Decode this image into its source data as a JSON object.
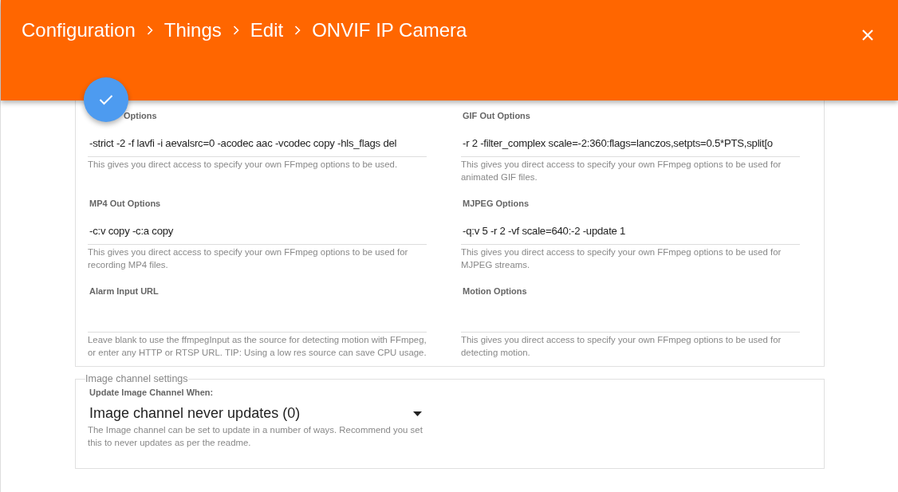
{
  "header": {
    "breadcrumb": [
      "Configuration",
      "Things",
      "Edit",
      "ONVIF IP Camera"
    ]
  },
  "options_group": {
    "fields": [
      {
        "label": "Options",
        "value": "-strict -2 -f lavfi -i aevalsrc=0 -acodec aac -vcodec copy -hls_flags del",
        "hint": "This gives you direct access to specify your own FFmpeg options to be used."
      },
      {
        "label": "GIF Out Options",
        "value": "-r 2 -filter_complex scale=-2:360:flags=lanczos,setpts=0.5*PTS,split[o",
        "hint": "This gives you direct access to specify your own FFmpeg options to be used for animated GIF files."
      },
      {
        "label": "MP4 Out Options",
        "value": "-c:v copy -c:a copy",
        "hint": "This gives you direct access to specify your own FFmpeg options to be used for recording MP4 files."
      },
      {
        "label": "MJPEG Options",
        "value": "-q:v 5 -r 2 -vf scale=640:-2 -update 1",
        "hint": "This gives you direct access to specify your own FFmpeg options to be used for MJPEG streams."
      },
      {
        "label": "Alarm Input URL",
        "hint": "Leave blank to use the ffmpegInput as the source for detecting motion with FFmpeg, or enter any HTTP or RTSP URL. TIP: Using a low res source can save CPU usage."
      },
      {
        "label": "Motion Options",
        "hint": "This gives you direct access to specify your own FFmpeg options to be used for detecting motion."
      }
    ]
  },
  "image_channel_group": {
    "legend": "Image channel settings",
    "label": "Update Image Channel When:",
    "value": "Image channel never updates (0)",
    "hint": "The Image channel can be set to update in a number of ways. Recommend you set this to never updates as per the readme."
  }
}
